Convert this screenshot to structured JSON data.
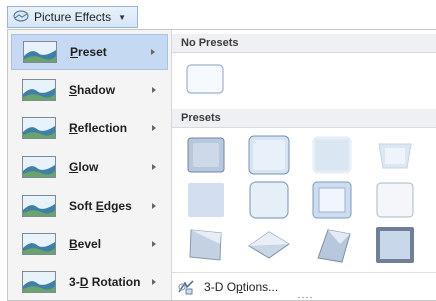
{
  "ribbon_button": {
    "label": "Picture Effects",
    "icon": "picture-effects-icon"
  },
  "ghost_text": "........",
  "menu": {
    "items": [
      {
        "label": "Preset",
        "mnemonic_index": 0,
        "active": true,
        "icon": "preset-thumb-icon"
      },
      {
        "label": "Shadow",
        "mnemonic_index": 0,
        "active": false,
        "icon": "shadow-thumb-icon"
      },
      {
        "label": "Reflection",
        "mnemonic_index": 0,
        "active": false,
        "icon": "reflection-thumb-icon"
      },
      {
        "label": "Glow",
        "mnemonic_index": 0,
        "active": false,
        "icon": "glow-thumb-icon"
      },
      {
        "label": "Soft Edges",
        "mnemonic_index": 5,
        "active": false,
        "icon": "soft-edges-thumb-icon"
      },
      {
        "label": "Bevel",
        "mnemonic_index": 0,
        "active": false,
        "icon": "bevel-thumb-icon"
      },
      {
        "label": "3-D Rotation",
        "mnemonic_index": 2,
        "active": false,
        "icon": "3d-rotation-thumb-icon"
      }
    ]
  },
  "gallery": {
    "no_presets_header": "No Presets",
    "presets_header": "Presets",
    "footer": {
      "label": "3-D Options...",
      "mnemonic_index": 5,
      "icon": "3d-options-icon"
    }
  },
  "colors": {
    "accent": "#c5d9f2",
    "header_bg": "#eef0f3",
    "tile_blue": "#9fb9d8"
  }
}
